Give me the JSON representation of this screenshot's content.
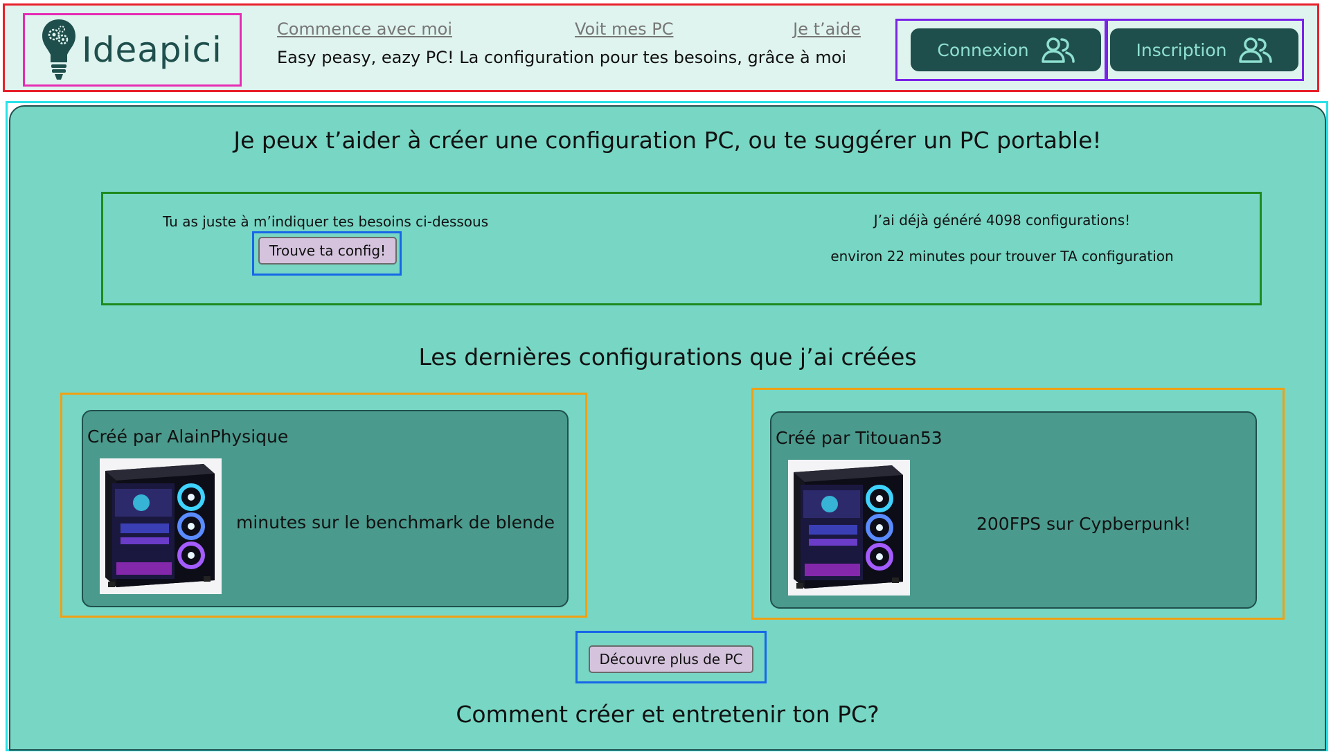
{
  "header": {
    "logo_text": "Ideapici",
    "nav": [
      {
        "label": "Commence avec moi"
      },
      {
        "label": "Voit mes PC"
      },
      {
        "label": "Je t’aide"
      }
    ],
    "tagline": "Easy peasy, eazy PC! La configuration pour tes besoins, grâce à moi",
    "login_label": "Connexion",
    "signup_label": "Inscription"
  },
  "main": {
    "title": "Je peux t’aider à créer une configuration PC, ou te suggérer un PC portable!",
    "intro": {
      "text": "Tu as juste à m’indiquer tes besoins ci-dessous",
      "button_label": "Trouve ta config!",
      "stat_generated": "J’ai déjà généré 4098 configurations!",
      "stat_time": "environ 22 minutes pour trouver TA configuration"
    },
    "latest_title": "Les dernières configurations que j’ai créées",
    "cards": [
      {
        "author": "Créé par AlainPhysique",
        "caption": "minutes sur le benchmark de blende"
      },
      {
        "author": "Créé par Titouan53",
        "caption": "200FPS sur Cypberpunk!"
      }
    ],
    "more_button_label": "Découvre plus de PC",
    "maintain_title": "Comment créer et entretenir ton PC?"
  },
  "colors": {
    "header_bg": "#dff4ee",
    "main_bg": "#77d6c4",
    "card_bg": "#4a9a8d",
    "brand_dark": "#1f4f4d",
    "button_bg": "#d5c3dd"
  },
  "icons": {
    "logo": "lightbulb-gears-icon",
    "account": "users-icon",
    "pc": "gaming-pc-case-image"
  }
}
